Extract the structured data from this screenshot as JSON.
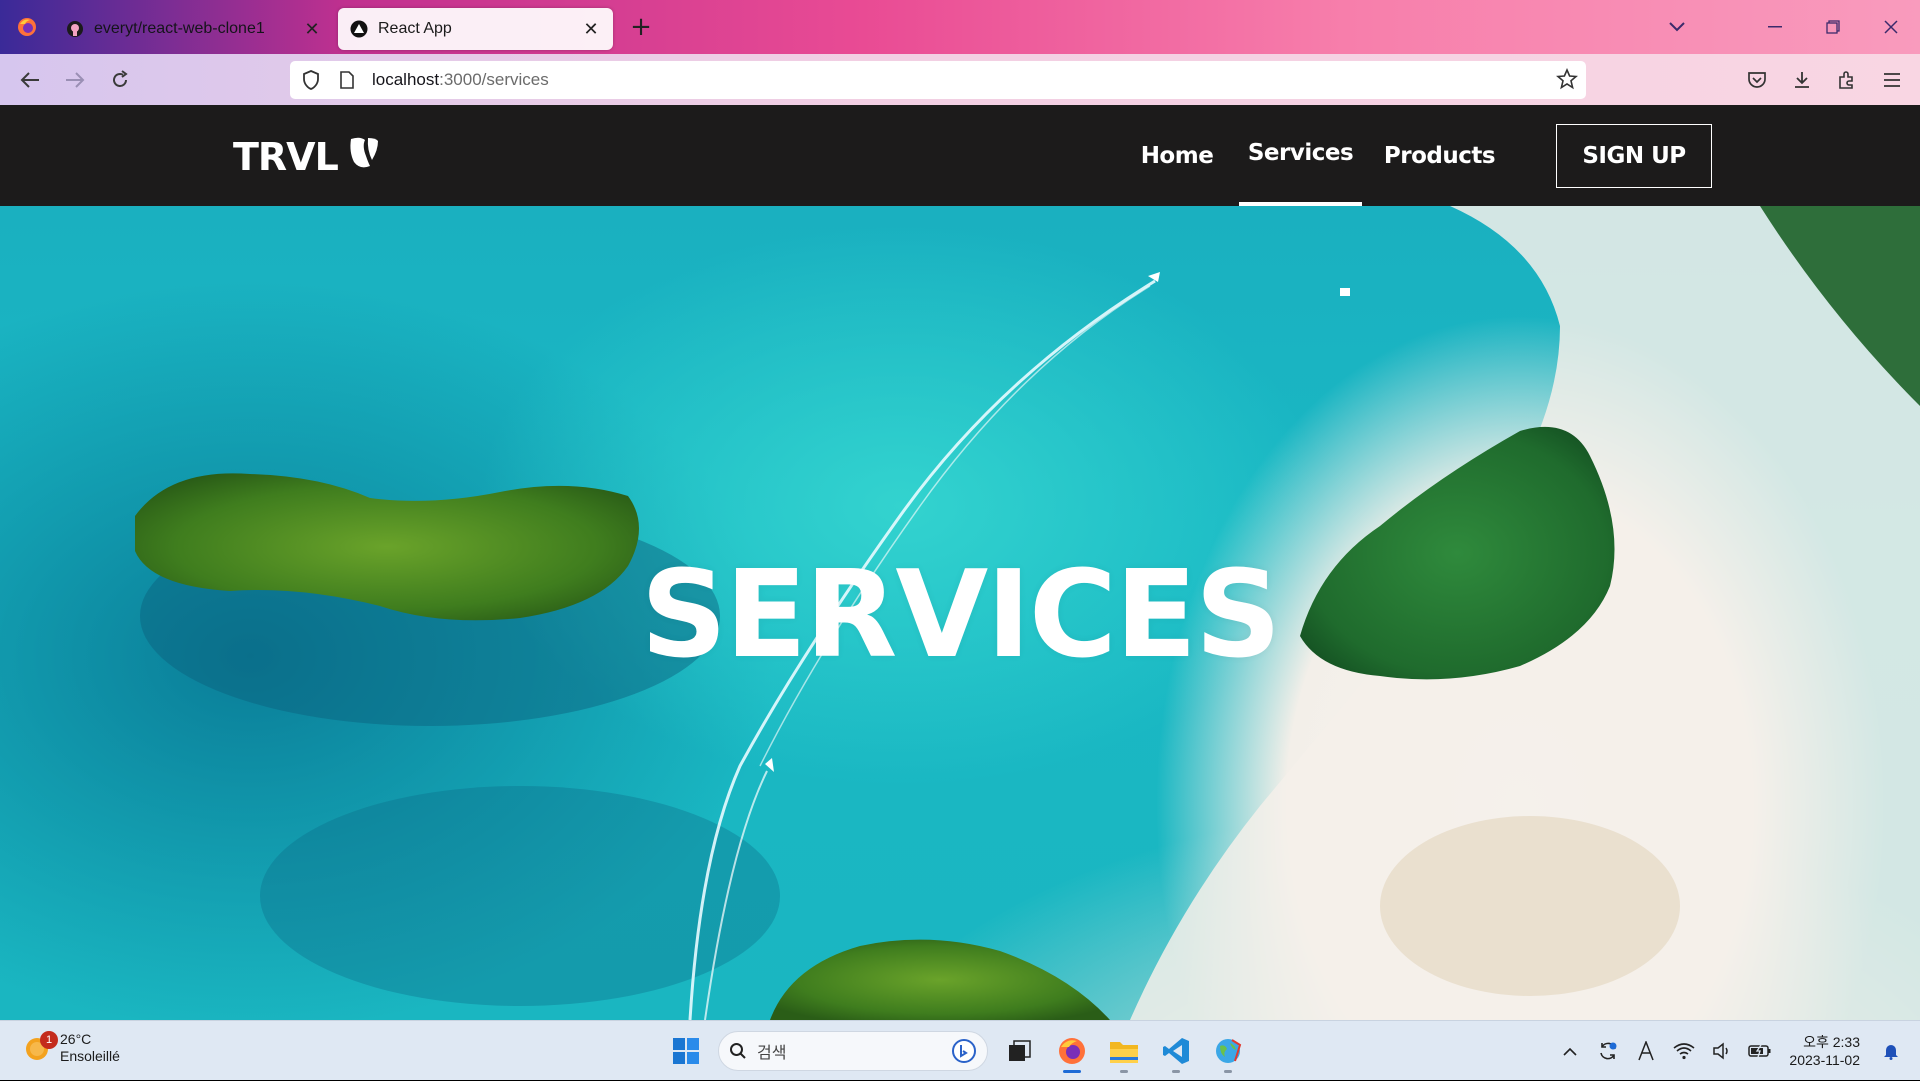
{
  "browser": {
    "tabs": [
      {
        "label": "everyt/react-web-clone1",
        "icon": "github-icon",
        "active": false
      },
      {
        "label": "React App",
        "icon": "react-app-icon",
        "active": true
      }
    ],
    "url_host": "localhost",
    "url_path": ":3000/services"
  },
  "site": {
    "logo_text": "TRVL",
    "nav": {
      "home": "Home",
      "services": "Services",
      "products": "Products",
      "signup": "SIGN UP"
    },
    "hero_title": "SERVICES"
  },
  "taskbar": {
    "weather_temp": "26°C",
    "weather_desc": "Ensoleillé",
    "weather_badge": "1",
    "search_placeholder": "검색",
    "time": "오후 2:33",
    "date": "2023-11-02"
  },
  "colors": {
    "nav_bg": "#1c1b1b",
    "sea": "#1ab6c1",
    "sand": "#f3efe9"
  }
}
